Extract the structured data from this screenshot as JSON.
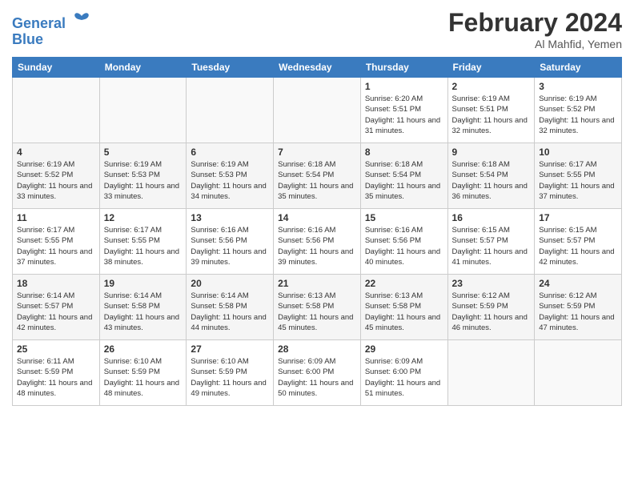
{
  "logo": {
    "line1": "General",
    "line2": "Blue"
  },
  "title": "February 2024",
  "subtitle": "Al Mahfid, Yemen",
  "days_of_week": [
    "Sunday",
    "Monday",
    "Tuesday",
    "Wednesday",
    "Thursday",
    "Friday",
    "Saturday"
  ],
  "weeks": [
    [
      {
        "day": "",
        "empty": true
      },
      {
        "day": "",
        "empty": true
      },
      {
        "day": "",
        "empty": true
      },
      {
        "day": "",
        "empty": true
      },
      {
        "day": "1",
        "sunrise": "6:20 AM",
        "sunset": "5:51 PM",
        "daylight": "11 hours and 31 minutes."
      },
      {
        "day": "2",
        "sunrise": "6:19 AM",
        "sunset": "5:51 PM",
        "daylight": "11 hours and 32 minutes."
      },
      {
        "day": "3",
        "sunrise": "6:19 AM",
        "sunset": "5:52 PM",
        "daylight": "11 hours and 32 minutes."
      }
    ],
    [
      {
        "day": "4",
        "sunrise": "6:19 AM",
        "sunset": "5:52 PM",
        "daylight": "11 hours and 33 minutes."
      },
      {
        "day": "5",
        "sunrise": "6:19 AM",
        "sunset": "5:53 PM",
        "daylight": "11 hours and 33 minutes."
      },
      {
        "day": "6",
        "sunrise": "6:19 AM",
        "sunset": "5:53 PM",
        "daylight": "11 hours and 34 minutes."
      },
      {
        "day": "7",
        "sunrise": "6:18 AM",
        "sunset": "5:54 PM",
        "daylight": "11 hours and 35 minutes."
      },
      {
        "day": "8",
        "sunrise": "6:18 AM",
        "sunset": "5:54 PM",
        "daylight": "11 hours and 35 minutes."
      },
      {
        "day": "9",
        "sunrise": "6:18 AM",
        "sunset": "5:54 PM",
        "daylight": "11 hours and 36 minutes."
      },
      {
        "day": "10",
        "sunrise": "6:17 AM",
        "sunset": "5:55 PM",
        "daylight": "11 hours and 37 minutes."
      }
    ],
    [
      {
        "day": "11",
        "sunrise": "6:17 AM",
        "sunset": "5:55 PM",
        "daylight": "11 hours and 37 minutes."
      },
      {
        "day": "12",
        "sunrise": "6:17 AM",
        "sunset": "5:55 PM",
        "daylight": "11 hours and 38 minutes."
      },
      {
        "day": "13",
        "sunrise": "6:16 AM",
        "sunset": "5:56 PM",
        "daylight": "11 hours and 39 minutes."
      },
      {
        "day": "14",
        "sunrise": "6:16 AM",
        "sunset": "5:56 PM",
        "daylight": "11 hours and 39 minutes."
      },
      {
        "day": "15",
        "sunrise": "6:16 AM",
        "sunset": "5:56 PM",
        "daylight": "11 hours and 40 minutes."
      },
      {
        "day": "16",
        "sunrise": "6:15 AM",
        "sunset": "5:57 PM",
        "daylight": "11 hours and 41 minutes."
      },
      {
        "day": "17",
        "sunrise": "6:15 AM",
        "sunset": "5:57 PM",
        "daylight": "11 hours and 42 minutes."
      }
    ],
    [
      {
        "day": "18",
        "sunrise": "6:14 AM",
        "sunset": "5:57 PM",
        "daylight": "11 hours and 42 minutes."
      },
      {
        "day": "19",
        "sunrise": "6:14 AM",
        "sunset": "5:58 PM",
        "daylight": "11 hours and 43 minutes."
      },
      {
        "day": "20",
        "sunrise": "6:14 AM",
        "sunset": "5:58 PM",
        "daylight": "11 hours and 44 minutes."
      },
      {
        "day": "21",
        "sunrise": "6:13 AM",
        "sunset": "5:58 PM",
        "daylight": "11 hours and 45 minutes."
      },
      {
        "day": "22",
        "sunrise": "6:13 AM",
        "sunset": "5:58 PM",
        "daylight": "11 hours and 45 minutes."
      },
      {
        "day": "23",
        "sunrise": "6:12 AM",
        "sunset": "5:59 PM",
        "daylight": "11 hours and 46 minutes."
      },
      {
        "day": "24",
        "sunrise": "6:12 AM",
        "sunset": "5:59 PM",
        "daylight": "11 hours and 47 minutes."
      }
    ],
    [
      {
        "day": "25",
        "sunrise": "6:11 AM",
        "sunset": "5:59 PM",
        "daylight": "11 hours and 48 minutes."
      },
      {
        "day": "26",
        "sunrise": "6:10 AM",
        "sunset": "5:59 PM",
        "daylight": "11 hours and 48 minutes."
      },
      {
        "day": "27",
        "sunrise": "6:10 AM",
        "sunset": "5:59 PM",
        "daylight": "11 hours and 49 minutes."
      },
      {
        "day": "28",
        "sunrise": "6:09 AM",
        "sunset": "6:00 PM",
        "daylight": "11 hours and 50 minutes."
      },
      {
        "day": "29",
        "sunrise": "6:09 AM",
        "sunset": "6:00 PM",
        "daylight": "11 hours and 51 minutes."
      },
      {
        "day": "",
        "empty": true
      },
      {
        "day": "",
        "empty": true
      }
    ]
  ]
}
